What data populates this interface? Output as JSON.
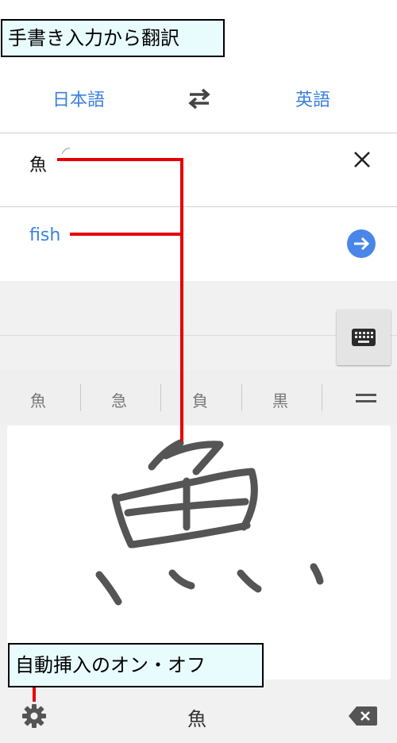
{
  "callouts": {
    "top": "手書き入力から翻訳",
    "bottom": "自動挿入のオン・オフ"
  },
  "languages": {
    "source": "日本語",
    "target": "英語"
  },
  "input": {
    "source_text": "魚",
    "translation": "fish"
  },
  "candidates": [
    "魚",
    "急",
    "負",
    "黒"
  ],
  "bottom_bar": {
    "committed_char": "魚"
  },
  "icons": {
    "swap": "swap-arrows-icon",
    "close": "close-icon",
    "go": "arrow-right-circle-icon",
    "keyboard": "keyboard-icon",
    "menu": "menu-icon",
    "settings": "gear-icon",
    "backspace": "backspace-icon"
  },
  "colors": {
    "accent": "#3b7fe0",
    "callout_bg": "#e8fbfd",
    "annotation_line": "#e50000",
    "ink": "#555555"
  }
}
